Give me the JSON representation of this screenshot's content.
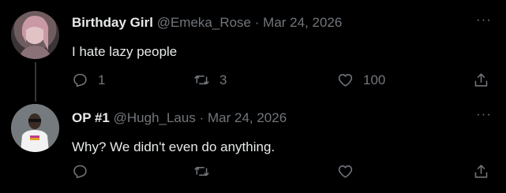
{
  "tweets": [
    {
      "display_name": "Birthday Girl",
      "handle": "@Emeka_Rose",
      "separator": "·",
      "date": "Mar 24, 2026",
      "more": "···",
      "text": "I hate lazy people",
      "reply_count": "1",
      "retweet_count": "3",
      "like_count": "100"
    },
    {
      "display_name": "OP #1",
      "handle": "@Hugh_Laus",
      "separator": "·",
      "date": "Mar 24, 2026",
      "more": "···",
      "text": "Why? We didn't even do anything.",
      "reply_count": "",
      "retweet_count": "",
      "like_count": ""
    }
  ],
  "icons": [
    "reply-icon",
    "retweet-icon",
    "like-icon",
    "share-icon",
    "more-icon"
  ],
  "colors": {
    "background": "#000000",
    "text": "#e7e9ea",
    "muted": "#71767b",
    "thread_line": "#333639"
  }
}
